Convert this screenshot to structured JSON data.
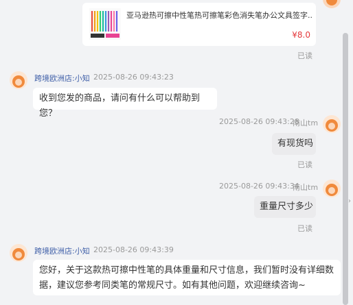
{
  "product": {
    "title": "亚马逊热可擦中性笔热可擦笔彩色消失笔办公文具签字...",
    "price": "¥8.0",
    "read": "已读"
  },
  "messages": [
    {
      "sender": "跨境欧洲店:小知",
      "time": "2025-08-26 09:43:23",
      "text": "收到您发的商品，请问有什么可以帮助到您？"
    },
    {
      "sender": "南山tm",
      "time": "2025-08-26 09:43:28",
      "text": "有现货吗",
      "read": "已读"
    },
    {
      "sender": "南山tm",
      "time": "2025-08-26 09:43:34",
      "text": "重量尺寸多少",
      "read": "已读"
    },
    {
      "sender": "跨境欧洲店:小知",
      "time": "2025-08-26 09:43:39",
      "text": "您好，关于这款热可擦中性笔的具体重量和尺寸信息，我们暂时没有详细数据，建议您参考同类笔的常规尺寸。如有其他问题，欢迎继续咨询~"
    }
  ],
  "colors": {
    "price": "#e4393c",
    "sender_name": "#3f5fa8",
    "background": "#f2f3f5"
  },
  "icons": {
    "avatar": "cartoon-lion-avatar-icon",
    "scroll": "chevron-right-icon"
  }
}
